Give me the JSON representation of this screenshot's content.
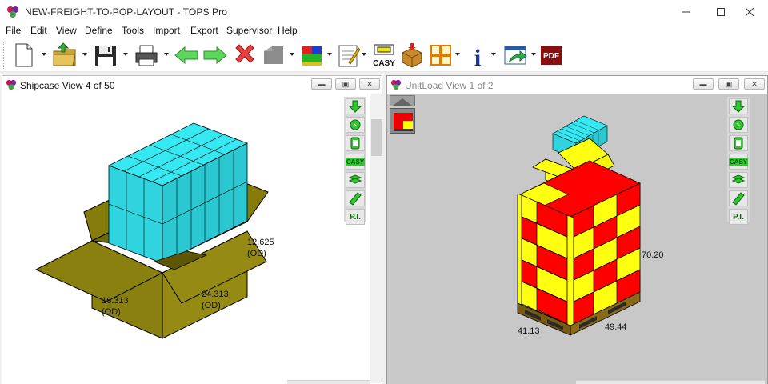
{
  "window": {
    "title": "NEW-FREIGHT-TO-POP-LAYOUT - TOPS Pro"
  },
  "menu": [
    "File",
    "Edit",
    "View",
    "Define",
    "Tools",
    "Import",
    "Export",
    "Supervisor",
    "Help"
  ],
  "toolbar": {
    "casy_label": "CASY",
    "pdf_label": "PDF",
    "info_label": "i",
    "icons": [
      "new-file-icon",
      "open-folder-icon",
      "save-icon",
      "print-icon",
      "back-arrow-icon",
      "forward-arrow-icon",
      "delete-icon",
      "shape-icon",
      "pallet-color-icon",
      "notepad-icon",
      "casy-icon",
      "load-box-icon",
      "layout-grid-icon",
      "info-icon",
      "export-window-icon",
      "pdf-icon"
    ]
  },
  "shipcase_view": {
    "title": "Shipcase View  4 of 50",
    "dim_height": "12.625",
    "dim_height_unit": "(OD)",
    "dim_length": "24.313",
    "dim_length_unit": "(OD)",
    "dim_width": "16.313",
    "dim_width_unit": "(OD)"
  },
  "unitload_view": {
    "title": "UnitLoad View  1 of 2",
    "dim_height": "70.20",
    "dim_width": "41.13",
    "dim_length": "49.44"
  },
  "side_panel": {
    "casy_label": "CASY",
    "pi_label": "P.I."
  },
  "colors": {
    "case_cyan": "#2ee6f0",
    "box_olive": "#8a8010",
    "layer_red": "#ff0000",
    "layer_yellow": "#ffff00",
    "pallet_brown": "#7a5a10",
    "canvas_gray": "#c8c8c8"
  }
}
